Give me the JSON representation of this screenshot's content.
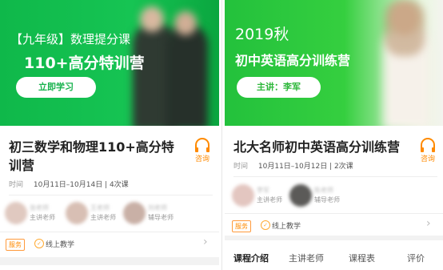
{
  "left_card": {
    "banner": {
      "subtitle": "【九年级】数理提分课",
      "headline": "110+高分特训营",
      "cta": "立即学习"
    },
    "title": "初三数学和物理110+高分特训营",
    "consult_label": "咨询",
    "meta_key": "时间",
    "meta_value": "10月11日–10月14日 | 4次课",
    "teachers": [
      {
        "name": "张老师",
        "role": "主讲老师"
      },
      {
        "name": "王老师",
        "role": "主讲老师"
      },
      {
        "name": "刘老师",
        "role": "辅导老师"
      }
    ],
    "service_badge": "服务",
    "service_text": "线上教学"
  },
  "right_card": {
    "banner": {
      "subtitle": "2019秋",
      "headline": "初中英语高分训练营",
      "cta": "主讲：李军"
    },
    "title": "北大名师初中英语高分训练营",
    "consult_label": "咨询",
    "meta_key": "时间",
    "meta_value": "10月11日–10月12日 | 2次课",
    "teachers": [
      {
        "name": "李军",
        "role": "主讲老师"
      },
      {
        "name": "陈老师",
        "role": "辅导老师"
      }
    ],
    "service_badge": "服务",
    "service_text": "线上教学",
    "tabs": [
      {
        "label": "课程介绍",
        "active": true
      },
      {
        "label": "主讲老师",
        "active": false
      },
      {
        "label": "课程表",
        "active": false
      },
      {
        "label": "评价",
        "active": false
      }
    ]
  },
  "icons": {
    "consult": "headset-icon",
    "check": "check-circle-icon",
    "chevron": "chevron-right-icon"
  },
  "colors": {
    "brand_green": "#16c453",
    "accent_orange": "#ff8a00"
  }
}
